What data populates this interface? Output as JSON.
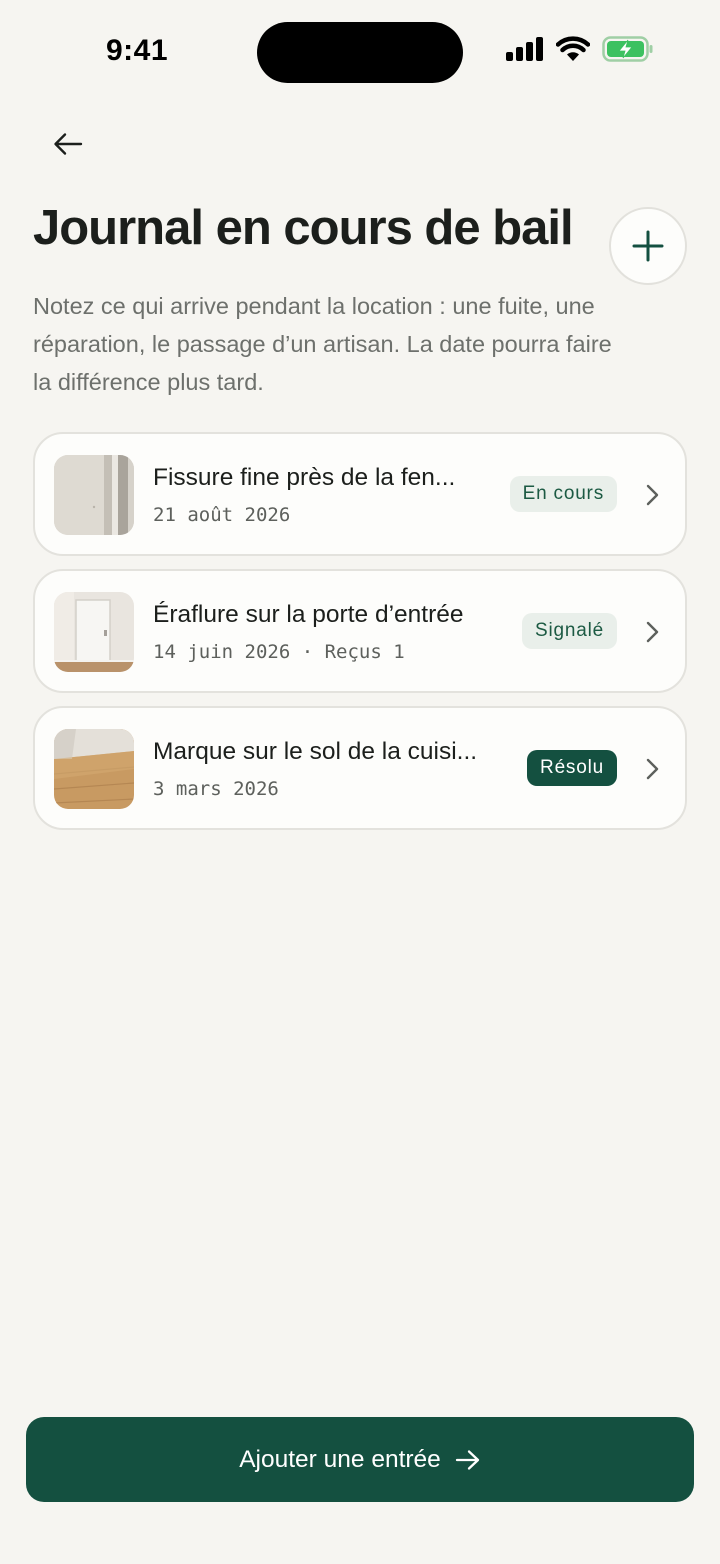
{
  "status_bar": {
    "time": "9:41",
    "icons": [
      "signal-icon",
      "wifi-icon",
      "battery-charging-icon"
    ]
  },
  "header": {
    "title": "Journal en cours de bail",
    "subtitle": "Notez ce qui arrive pendant la location : une fuite, une réparation, le passage d’un artisan. La date pourra faire la différence plus tard."
  },
  "entries": [
    {
      "title": "Fissure fine près de la fen...",
      "meta": "21 août 2026",
      "status": "En cours",
      "status_style": "light",
      "thumb": "wall-photo"
    },
    {
      "title": "Éraflure sur la porte d’entrée",
      "meta": "14 juin 2026 · Reçus 1",
      "status": "Signalé",
      "status_style": "light",
      "thumb": "door-photo"
    },
    {
      "title": "Marque sur le sol de la cuisi...",
      "meta": "3 mars 2026",
      "status": "Résolu",
      "status_style": "dark",
      "thumb": "floor-photo"
    }
  ],
  "cta": {
    "label": "Ajouter une entrée"
  },
  "colors": {
    "background": "#f6f5f1",
    "accent": "#145040",
    "badge_light_bg": "#e9efea",
    "text_muted": "#6d706c"
  }
}
